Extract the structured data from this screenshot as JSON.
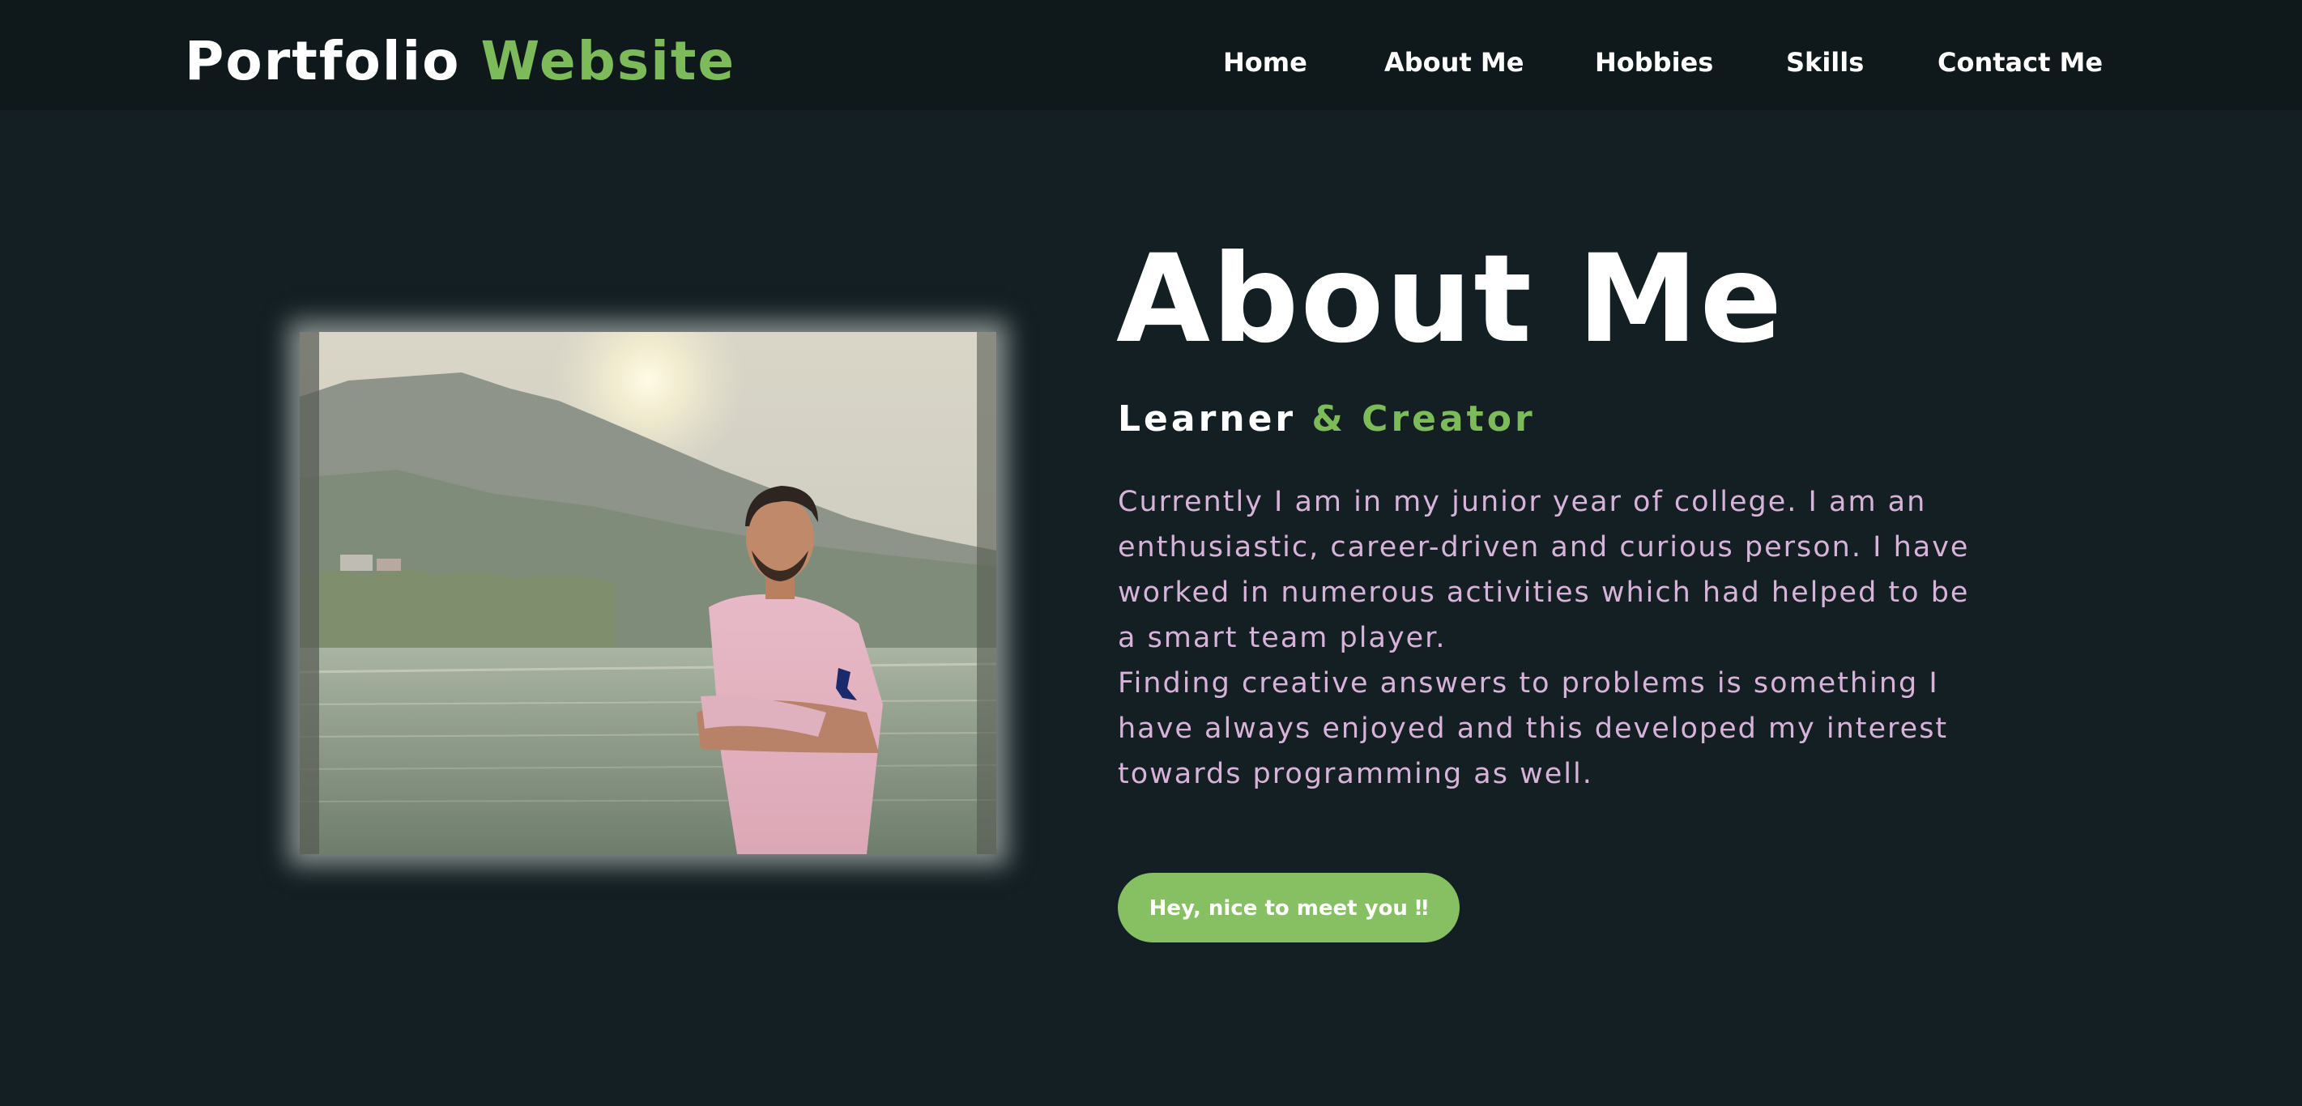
{
  "header": {
    "logo_main": "Portfolio",
    "logo_accent": "Website"
  },
  "nav": {
    "items": [
      {
        "label": "Home"
      },
      {
        "label": "About Me"
      },
      {
        "label": "Hobbies"
      },
      {
        "label": "Skills"
      },
      {
        "label": "Contact Me"
      }
    ]
  },
  "about": {
    "title": "About Me",
    "subtitle_main": "Learner",
    "subtitle_accent": "& Creator",
    "paragraph_1": "Currently I am in my junior year of college. I am an enthusiastic, career-driven and curious person. I have worked in numerous activities which had helped to be a smart team player.",
    "paragraph_2": "Finding creative answers to problems is something I have always enjoyed and this developed my interest towards programming as well.",
    "cta_label": "Hey, nice to meet you ‼"
  },
  "colors": {
    "background": "#131f23",
    "header_background": "#0f191c",
    "accent_green": "#7dbb5a",
    "button_green": "#86c063",
    "body_text_pink": "#d7b3d9"
  }
}
